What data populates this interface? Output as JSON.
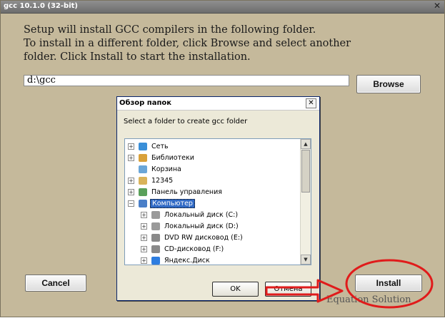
{
  "window": {
    "title": "gcc 10.1.0 (32-bit)",
    "close_glyph": "✕"
  },
  "setup": {
    "lines": [
      "Setup will install GCC compilers in the following folder.",
      "To install in a different folder, click Browse and select another",
      "folder. Click Install to start the installation."
    ],
    "path_value": "d:\\gcc"
  },
  "buttons": {
    "browse": "Browse",
    "cancel": "Cancel",
    "install": "Install"
  },
  "watermark": "Equation Solution",
  "dialog": {
    "title": "Обзор папок",
    "close_glyph": "✕",
    "instruction": "Select a folder to create gcc folder",
    "tree": [
      {
        "label": "Сеть",
        "icon": "network-icon",
        "expander": "+"
      },
      {
        "label": "Библиотеки",
        "icon": "libraries-icon",
        "expander": "+"
      },
      {
        "label": "Корзина",
        "icon": "recycle-bin-icon",
        "expander": ""
      },
      {
        "label": "12345",
        "icon": "user-folder-icon",
        "expander": "+"
      },
      {
        "label": "Панель управления",
        "icon": "control-panel-icon",
        "expander": "+"
      },
      {
        "label": "Компьютер",
        "icon": "computer-icon",
        "expander": "−",
        "selected": true
      },
      {
        "label": "Локальный диск (C:)",
        "icon": "drive-icon",
        "expander": "+"
      },
      {
        "label": "Локальный диск (D:)",
        "icon": "drive-icon",
        "expander": "+"
      },
      {
        "label": "DVD RW дисковод (E:)",
        "icon": "dvd-drive-icon",
        "expander": "+"
      },
      {
        "label": "CD-дисковод (F:)",
        "icon": "cd-drive-icon",
        "expander": "+"
      },
      {
        "label": "Яндекс.Диск",
        "icon": "yandex-disk-icon",
        "expander": "+"
      }
    ],
    "ok": "OK",
    "cancel": "Отмена"
  },
  "colors": {
    "annotation_red": "#e01b1b",
    "selection": "#316ac5"
  }
}
